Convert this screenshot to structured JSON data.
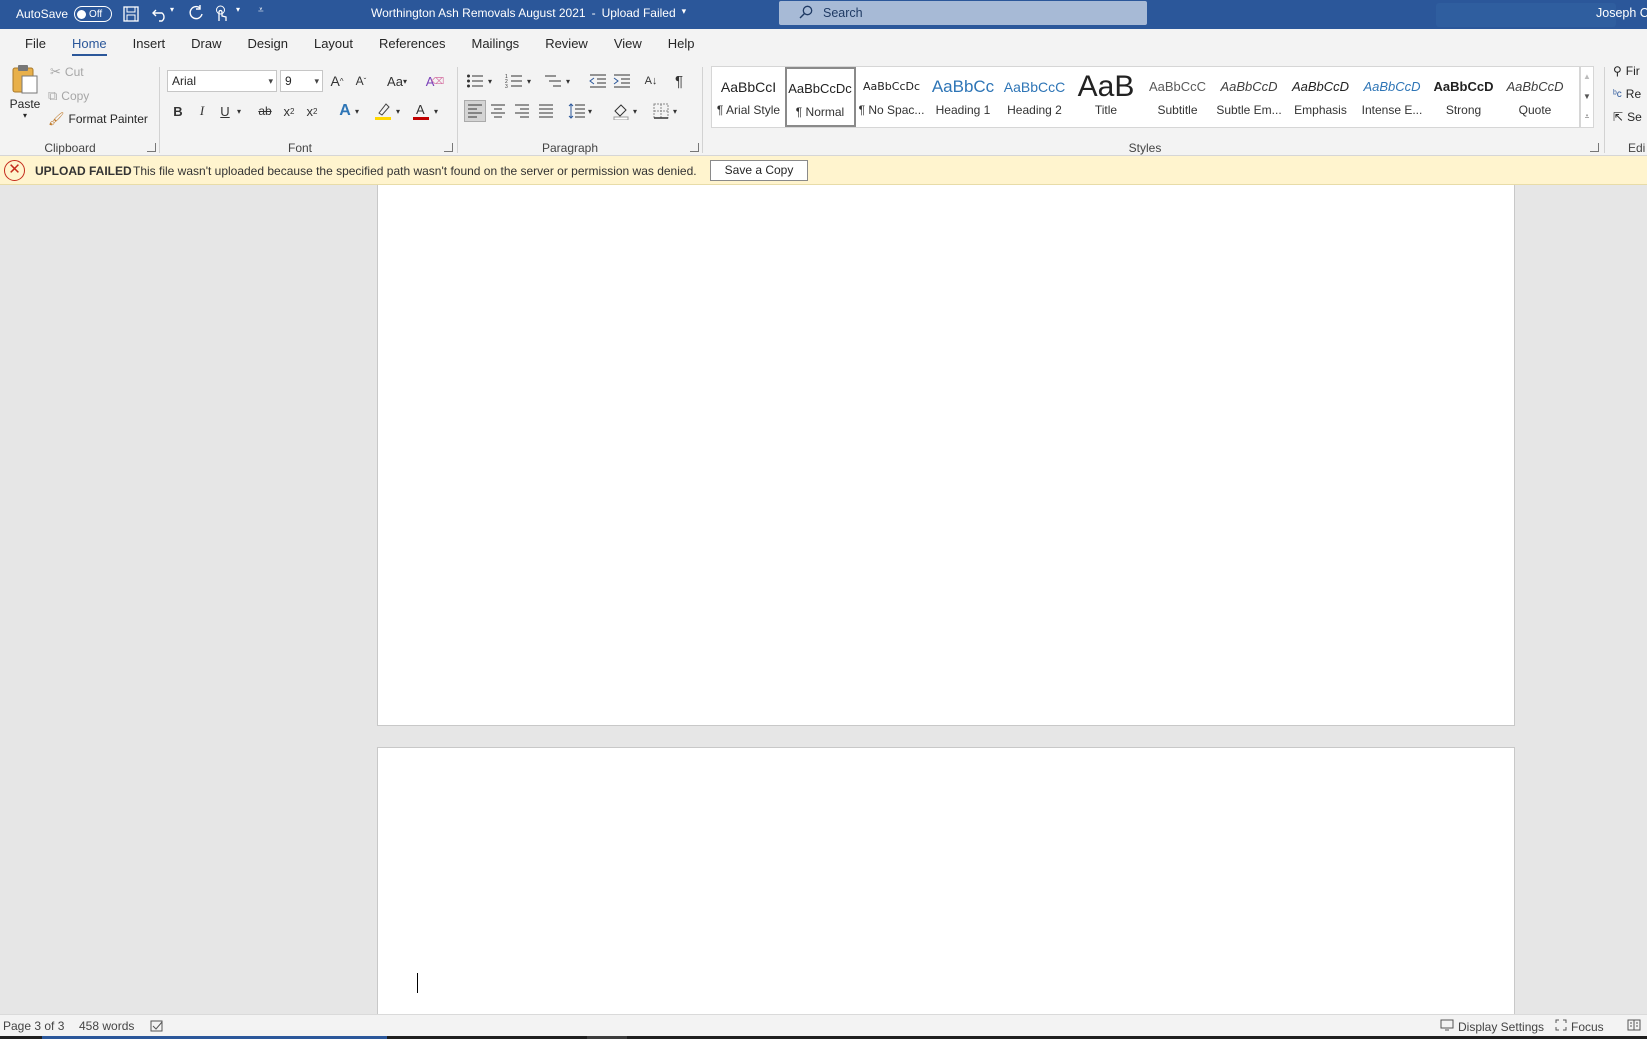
{
  "titlebar": {
    "autosave_label": "AutoSave",
    "autosave_state": "Off",
    "doc_title": "Worthington Ash Removals August 2021",
    "separator": "-",
    "doc_status": "Upload Failed",
    "search_placeholder": "Search",
    "user_name": "Joseph Cr"
  },
  "menu": {
    "tabs": [
      "File",
      "Home",
      "Insert",
      "Draw",
      "Design",
      "Layout",
      "References",
      "Mailings",
      "Review",
      "View",
      "Help"
    ],
    "active": "Home"
  },
  "clipboard": {
    "paste": "Paste",
    "cut": "Cut",
    "copy": "Copy",
    "format_painter": "Format Painter",
    "label": "Clipboard"
  },
  "font": {
    "name": "Arial",
    "size": "9",
    "change_case": "Aa",
    "label": "Font"
  },
  "paragraph": {
    "label": "Paragraph"
  },
  "styles": {
    "label": "Styles",
    "items": [
      {
        "sample": "AaBbCcI",
        "name": "¶ Arial Style"
      },
      {
        "sample": "AaBbCcDc",
        "name": "¶ Normal"
      },
      {
        "sample": "AaBbCcDc",
        "name": "¶ No Spac..."
      },
      {
        "sample": "AaBbCc",
        "name": "Heading 1"
      },
      {
        "sample": "AaBbCcC",
        "name": "Heading 2"
      },
      {
        "sample": "AaB",
        "name": "Title"
      },
      {
        "sample": "AaBbCcC",
        "name": "Subtitle"
      },
      {
        "sample": "AaBbCcD",
        "name": "Subtle Em..."
      },
      {
        "sample": "AaBbCcD",
        "name": "Emphasis"
      },
      {
        "sample": "AaBbCcD",
        "name": "Intense E..."
      },
      {
        "sample": "AaBbCcD",
        "name": "Strong"
      },
      {
        "sample": "AaBbCcD",
        "name": "Quote"
      }
    ]
  },
  "editing": {
    "find": "Fir",
    "replace": "Re",
    "select": "Se",
    "label": "Edi"
  },
  "message_bar": {
    "title": "UPLOAD FAILED",
    "text": "This file wasn't uploaded because the specified path wasn't found on the server or permission was denied.",
    "button": "Save a Copy"
  },
  "status": {
    "page": "Page 3 of 3",
    "words": "458 words",
    "display_settings": "Display Settings",
    "focus": "Focus"
  },
  "colors": {
    "brand": "#2b579a",
    "message_bg": "#fff4ce",
    "error": "#c42b1c",
    "highlight": "#ffd700",
    "font_color": "#c00000"
  }
}
